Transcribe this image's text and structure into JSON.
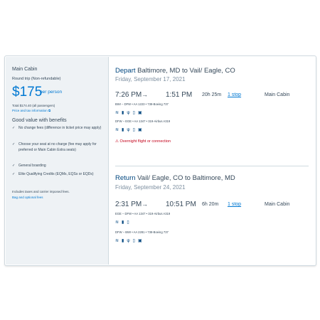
{
  "summary": {
    "cabin": "Main Cabin",
    "trip_type": "Round trip (Non-refundable)",
    "price": "$175",
    "per_person": "per person",
    "total": "Total $174.40 (all passengers)",
    "price_link": "Price and tax information",
    "benefits_title": "Good value with benefits",
    "benefits": [
      "No change fees (difference in ticket price may apply)",
      "Choose your seat at no charge (fee may apply for preferred or Main Cabin Extra seats)",
      "General boarding",
      "Elite Qualifying Credits (EQMs, EQSs or EQDs)"
    ],
    "fees_note": "Includes taxes and carrier imposed fees.",
    "bag_link": "Bag and optional fees"
  },
  "depart": {
    "lead": "Depart",
    "route": "Baltimore, MD to Vail/ Eagle, CO",
    "date": "Friday, September 17, 2021",
    "dep_time": "7:26 PM",
    "arr_time": "1:51 PM",
    "duration": "20h 25m",
    "stops": "1 stop",
    "cabin": "Main Cabin",
    "leg1": "BWI – DFW  •  AA 1223  •  738-Boeing 737",
    "leg2": "DFW – EGE  •  AA 1347  •  319-Airbus A319",
    "amenities": "wifi-icon, tv-icon, power-icon, phone-icon, film-icon",
    "warning": "Overnight flight or connection"
  },
  "return": {
    "lead": "Return",
    "route": "Vail/ Eagle, CO to Baltimore, MD",
    "date": "Friday, September 24, 2021",
    "dep_time": "2:31 PM",
    "arr_time": "10:51 PM",
    "duration": "6h 20m",
    "stops": "1 stop",
    "cabin": "Main Cabin",
    "leg1": "EGE – DFW  •  AA 1347  •  319-Airbus A319",
    "leg2": "DFW – BWI  •  AA 2281  •  738-Boeing 737"
  },
  "icons": {
    "check": "✓",
    "link": "⧉",
    "arrow": "→",
    "warning": "⚠"
  },
  "colors": {
    "brand_blue": "#0078d2",
    "dark_blue": "#00467f",
    "text": "#36495a",
    "muted": "#7d8fa0",
    "warning": "#c30019",
    "panel_bg": "#eef2f5"
  }
}
